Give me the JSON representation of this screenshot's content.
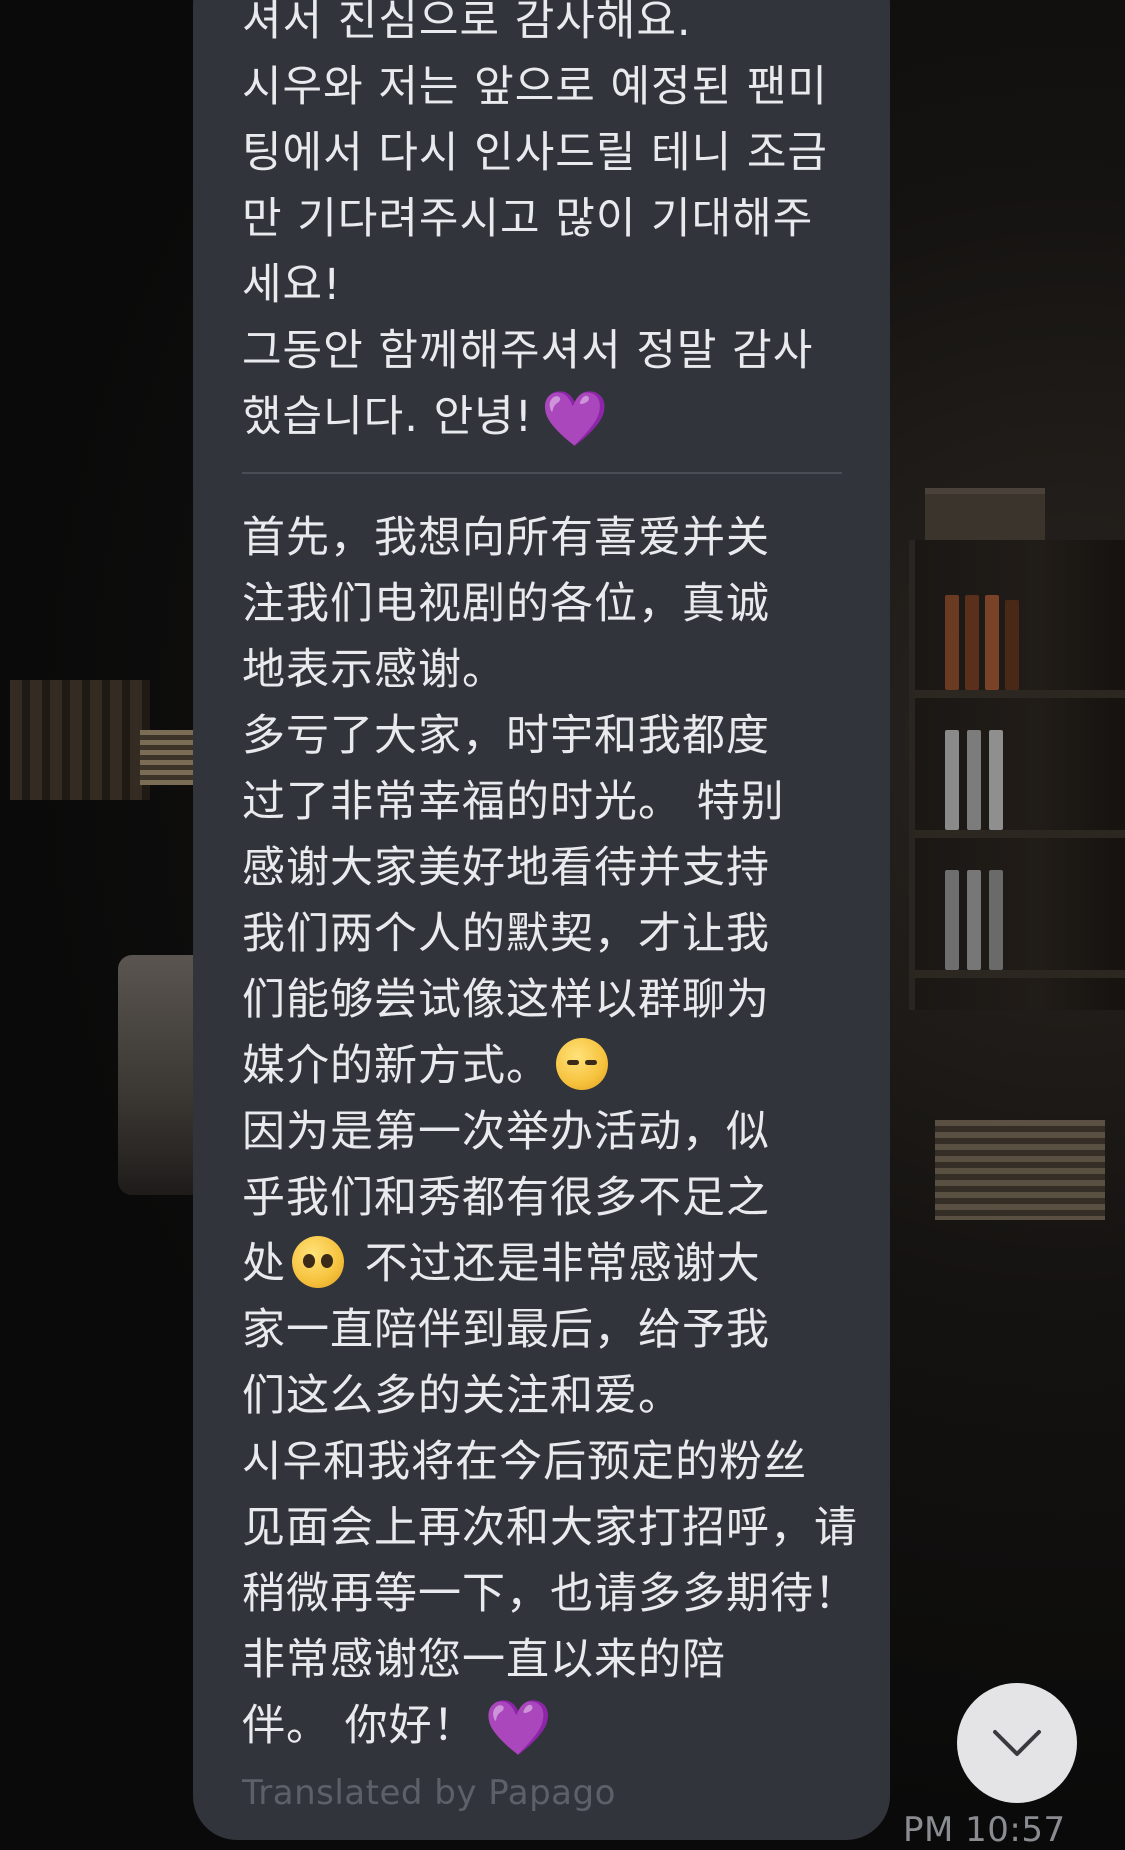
{
  "chat": {
    "message_korean": "셔서 진심으로 감사해요.\n시우와 저는 앞으로 예정된 팬미\n팅에서 다시 인사드릴 테니 조금\n만 기다려주시고 많이 기대해주\n세요!\n그동안 함께해주셔서 정말 감사\n했습니다. 안녕!",
    "message_chinese": {
      "part1": "首先，我想向所有喜爱并关\n注我们电视剧的各位，真诚\n地表示感谢。\n多亏了大家，时宇和我都度\n过了非常幸福的时光。 特别\n感谢大家美好地看待并支持\n我们两个人的默契，才让我\n们能够尝试像这样以群聊为\n媒介的新方式。",
      "part2": "\n因为是第一次举办活动，似\n乎我们和秀都有很多不足之\n处",
      "part3": " 不过还是非常感谢大\n家一直陪伴到最后，给予我\n们这么多的关注和爱。\n시우和我将在今后预定的粉丝\n见面会上再次和大家打招呼，请\n稍微再等一下，也请多多期待！\n非常感谢您一直以来的陪\n伴。 你好！"
    },
    "emoji_heart": "💜",
    "emoji_kissing_cat_icon": "kissing-cat-face",
    "emoji_pleading_icon": "pleading-face",
    "translated_by": "Translated by Papago",
    "timestamp": "PM 10:57"
  },
  "colors": {
    "bubble": "#31343b",
    "text": "#e9eaed",
    "heart": "#9b4de0",
    "scroll_button": "#e4e4e6"
  }
}
